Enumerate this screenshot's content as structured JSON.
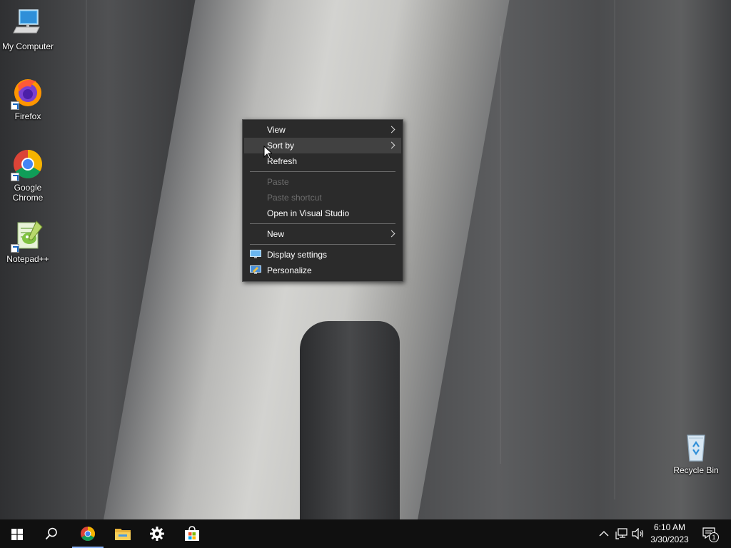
{
  "desktop": {
    "icons": [
      {
        "label": "My Computer",
        "icon": "computer-icon"
      },
      {
        "label": "Firefox",
        "icon": "firefox-icon"
      },
      {
        "label": "Google Chrome",
        "icon": "chrome-icon"
      },
      {
        "label": "Notepad++",
        "icon": "notepadpp-icon"
      },
      {
        "label": "Recycle Bin",
        "icon": "recycle-bin-icon"
      }
    ]
  },
  "context_menu": {
    "items": [
      {
        "label": "View",
        "submenu": true,
        "enabled": true
      },
      {
        "label": "Sort by",
        "submenu": true,
        "enabled": true,
        "hovered": true
      },
      {
        "label": "Refresh",
        "submenu": false,
        "enabled": true
      },
      {
        "label": "Paste",
        "submenu": false,
        "enabled": false
      },
      {
        "label": "Paste shortcut",
        "submenu": false,
        "enabled": false
      },
      {
        "label": "Open in Visual Studio",
        "submenu": false,
        "enabled": true
      },
      {
        "label": "New",
        "submenu": true,
        "enabled": true
      },
      {
        "label": "Display settings",
        "submenu": false,
        "enabled": true,
        "icon": "display-icon"
      },
      {
        "label": "Personalize",
        "submenu": false,
        "enabled": true,
        "icon": "personalize-icon"
      }
    ]
  },
  "taskbar": {
    "apps": [
      {
        "name": "Start",
        "icon": "windows-start-icon"
      },
      {
        "name": "Search",
        "icon": "search-icon"
      },
      {
        "name": "Google Chrome",
        "icon": "chrome-icon",
        "active": true
      },
      {
        "name": "File Explorer",
        "icon": "folder-icon"
      },
      {
        "name": "Settings",
        "icon": "gear-icon"
      },
      {
        "name": "Microsoft Store",
        "icon": "store-icon"
      }
    ],
    "tray": {
      "time": "6:10 AM",
      "date": "3/30/2023",
      "notification_count": "1"
    }
  },
  "colors": {
    "menu_bg": "#2b2b2b",
    "menu_hover": "#414141",
    "taskbar_bg": "#101010",
    "disabled_text": "#6d6d6d"
  }
}
